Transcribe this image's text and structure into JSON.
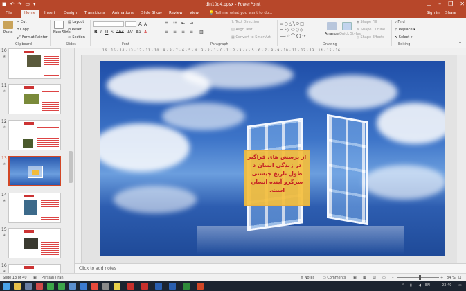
{
  "titlebar": {
    "title": "din10d4.ppsx - PowerPoint",
    "qat_icons": [
      "save-icon",
      "undo-icon",
      "redo-icon",
      "start-slideshow-icon",
      "customize-icon"
    ],
    "window_buttons": [
      "minimize-icon",
      "restore-icon",
      "close-icon"
    ]
  },
  "tabs": [
    {
      "label": "File"
    },
    {
      "label": "Home"
    },
    {
      "label": "Insert"
    },
    {
      "label": "Design"
    },
    {
      "label": "Transitions"
    },
    {
      "label": "Animations"
    },
    {
      "label": "Slide Show"
    },
    {
      "label": "Review"
    },
    {
      "label": "View"
    }
  ],
  "active_tab": "Home",
  "tellme": "Tell me what you want to do...",
  "signin": "Sign in",
  "share": "Share",
  "ribbon": {
    "clipboard": {
      "paste": "Paste",
      "cut": "Cut",
      "copy": "Copy",
      "format_painter": "Format Painter",
      "label": "Clipboard"
    },
    "slides": {
      "new_slide": "New Slide",
      "layout": "Layout",
      "reset": "Reset",
      "section": "Section",
      "label": "Slides"
    },
    "font": {
      "label": "Font"
    },
    "paragraph": {
      "text_direction": "Text Direction",
      "align_text": "Align Text",
      "convert_smartart": "Convert to SmartArt",
      "label": "Paragraph"
    },
    "drawing": {
      "arrange": "Arrange",
      "quick_styles": "Quick Styles",
      "shape_fill": "Shape Fill",
      "shape_outline": "Shape Outline",
      "shape_effects": "Shape Effects",
      "label": "Drawing"
    },
    "editing": {
      "find": "Find",
      "replace": "Replace",
      "select": "Select",
      "label": "Editing"
    }
  },
  "ruler_marks": "16 · 15 · 14 · 13 · 12 · 11 · 10 · 9 · 8 · 7 · 6 · 5 · 4 · 3 · 2 · 1 · 0 · 1 · 2 · 3 · 4 · 5 · 6 · 7 · 8 · 9 · 10 · 11 · 12 · 13 · 14 · 15 · 16",
  "thumbnails": [
    {
      "number": "10",
      "selected": false
    },
    {
      "number": "11",
      "selected": false
    },
    {
      "number": "12",
      "selected": false
    },
    {
      "number": "13",
      "selected": true
    },
    {
      "number": "14",
      "selected": false
    },
    {
      "number": "15",
      "selected": false
    },
    {
      "number": "16",
      "selected": false
    }
  ],
  "slide": {
    "text": "از پرسش های فراگیر در زندگی انسان د طول تاریخ چیستی سرگرو آینده انسان است."
  },
  "notes_placeholder": "Click to add notes",
  "status": {
    "slide_info": "Slide 13 of 40",
    "language": "Persian (Iran)",
    "notes": "Notes",
    "comments": "Comments",
    "zoom": "84 %"
  },
  "taskbar": {
    "lang": "EN",
    "time": "23:49"
  }
}
